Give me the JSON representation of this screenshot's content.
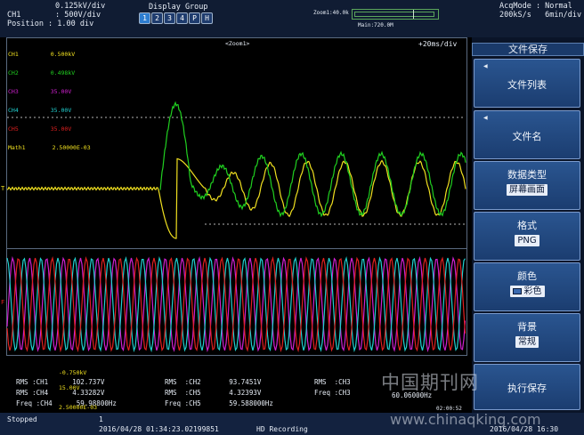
{
  "top": {
    "vdiv": "0.125kV/div",
    "ch_label": "CH1",
    "ch_scale": ": 500V/div",
    "position": "Position : 1.00 div",
    "display_group_title": "Display Group",
    "group_buttons": [
      "1",
      "2",
      "3",
      "4",
      "P",
      "H"
    ],
    "zoom_label": "Zoom1:40.0k",
    "main_label": "Main:720.0M",
    "acq_mode": "AcqMode : Normal",
    "acq_rate": "200kS/s   6min/div"
  },
  "scope": {
    "channels": [
      {
        "name": "CH1",
        "value": "0.500kV",
        "color": "#f0e020"
      },
      {
        "name": "CH2",
        "value": "0.498kV",
        "color": "#20d020"
      },
      {
        "name": "CH3",
        "value": "35.00V",
        "color": "#d020d0"
      },
      {
        "name": "CH4",
        "value": "35.00V",
        "color": "#20d0d0"
      },
      {
        "name": "CH5",
        "value": "35.00V",
        "color": "#e02020"
      },
      {
        "name": "Math1",
        "value": "2.50000E-03",
        "color": "#f0e020"
      }
    ],
    "zoom_tag": "<Zoom1>",
    "time_div": "+20ms/div"
  },
  "measurements": {
    "ylw_top": "-0.750kV",
    "rows": [
      [
        "RMS",
        ":CH1",
        "102.737V",
        "RMS",
        ":CH2",
        "93.7451V",
        "RMS",
        ":CH3"
      ],
      [
        "RMS",
        ":CH4",
        "4.33282V",
        "RMS",
        ":CH5",
        "4.32393V",
        "Freq",
        ":CH3"
      ],
      [
        "Freq",
        ":CH4",
        "59.98800Hz",
        "Freq",
        ":CH5",
        "59.588000Hz",
        "",
        ""
      ]
    ],
    "ylw_mid": "15.00V",
    "ylw_low": "2.50000E-03",
    "freq_value": "60.06000Hz",
    "time_tag": "02:00:52"
  },
  "menu": {
    "title": "文件保存",
    "items": [
      {
        "label": "文件列表",
        "value": ""
      },
      {
        "label": "文件名",
        "value": ""
      },
      {
        "label": "数据类型",
        "value": "屏幕画面"
      },
      {
        "label": "格式",
        "value": "PNG"
      },
      {
        "label": "颜色",
        "value": "彩色"
      },
      {
        "label": "背景",
        "value": "常规"
      },
      {
        "label": "执行保存",
        "value": ""
      }
    ]
  },
  "status": {
    "state": "Stopped",
    "count": "1",
    "timestamp": "2016/04/28 01:34:23.02199851",
    "recording": "HD Recording",
    "clock": "2016/04/28 16:30"
  },
  "watermark": {
    "cn": "中国期刊网",
    "url": "www.chinaqking.com"
  }
}
